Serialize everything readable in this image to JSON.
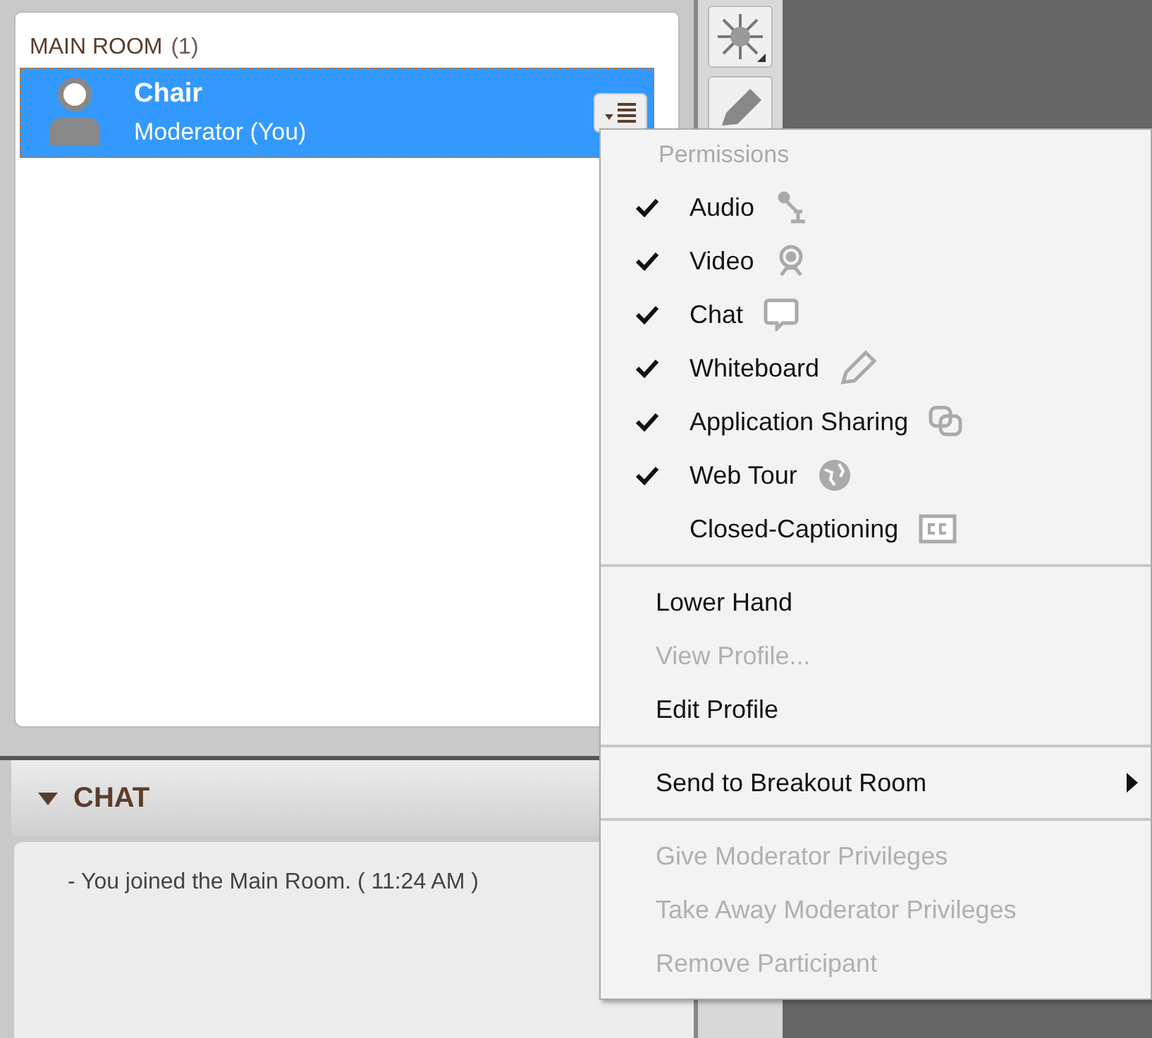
{
  "room": {
    "title": "MAIN ROOM",
    "count": "(1)"
  },
  "participants": [
    {
      "name": "Chair",
      "role": "Moderator (You)",
      "selected": true
    }
  ],
  "chat": {
    "title": "CHAT",
    "expanded": true,
    "messages": [
      "- You joined the Main Room. ( 11:24 AM )"
    ]
  },
  "menu": {
    "header": "Permissions",
    "permissions": [
      {
        "label": "Audio",
        "checked": true,
        "kind": "audio"
      },
      {
        "label": "Video",
        "checked": true,
        "kind": "video"
      },
      {
        "label": "Chat",
        "checked": true,
        "kind": "chat"
      },
      {
        "label": "Whiteboard",
        "checked": true,
        "kind": "whiteboard"
      },
      {
        "label": "Application Sharing",
        "checked": true,
        "kind": "sharing"
      },
      {
        "label": "Web Tour",
        "checked": true,
        "kind": "web"
      },
      {
        "label": "Closed-Captioning",
        "checked": false,
        "kind": "cc"
      }
    ],
    "sections": [
      [
        {
          "label": "Lower Hand",
          "disabled": false,
          "submenu": false
        },
        {
          "label": "View Profile...",
          "disabled": true,
          "submenu": false
        },
        {
          "label": "Edit Profile",
          "disabled": false,
          "submenu": false
        }
      ],
      [
        {
          "label": "Send to Breakout Room",
          "disabled": false,
          "submenu": true
        }
      ],
      [
        {
          "label": "Give Moderator Privileges",
          "disabled": true,
          "submenu": false
        },
        {
          "label": "Take Away Moderator Privileges",
          "disabled": true,
          "submenu": false
        },
        {
          "label": "Remove Participant",
          "disabled": true,
          "submenu": false
        }
      ]
    ]
  }
}
